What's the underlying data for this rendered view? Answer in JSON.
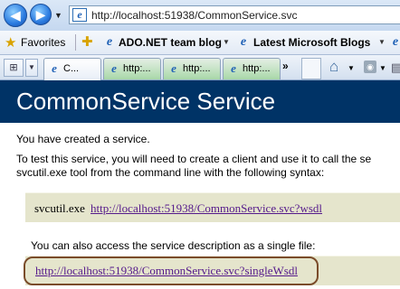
{
  "browser": {
    "address": "http://localhost:51938/CommonService.svc",
    "favorites_label": "Favorites",
    "fav_links": [
      "ADO.NET team blog",
      "Latest Microsoft Blogs"
    ],
    "tabs": [
      {
        "label": "C...",
        "active": true
      },
      {
        "label": "http:...",
        "active": false
      },
      {
        "label": "http:...",
        "active": false
      },
      {
        "label": "http:...",
        "active": false
      }
    ],
    "more_tabs": "»"
  },
  "page": {
    "title": "CommonService Service",
    "created_text": "You have created a service.",
    "instructions_line1": "To test this service, you will need to create a client and use it to call the se",
    "instructions_line2": "svcutil.exe tool from the command line with the following syntax:",
    "svcutil_cmd": "svcutil.exe",
    "wsdl_link": "http://localhost:51938/CommonService.svc?wsdl",
    "single_file_text": "You can also access the service description as a single file:",
    "single_wsdl_link": "http://localhost:51938/CommonService.svc?singleWsdl"
  },
  "colors": {
    "header_band": "#003366",
    "code_box": "#e5e5cc",
    "visited_link": "#551a8b",
    "highlight_ring": "#7a4c2a"
  }
}
